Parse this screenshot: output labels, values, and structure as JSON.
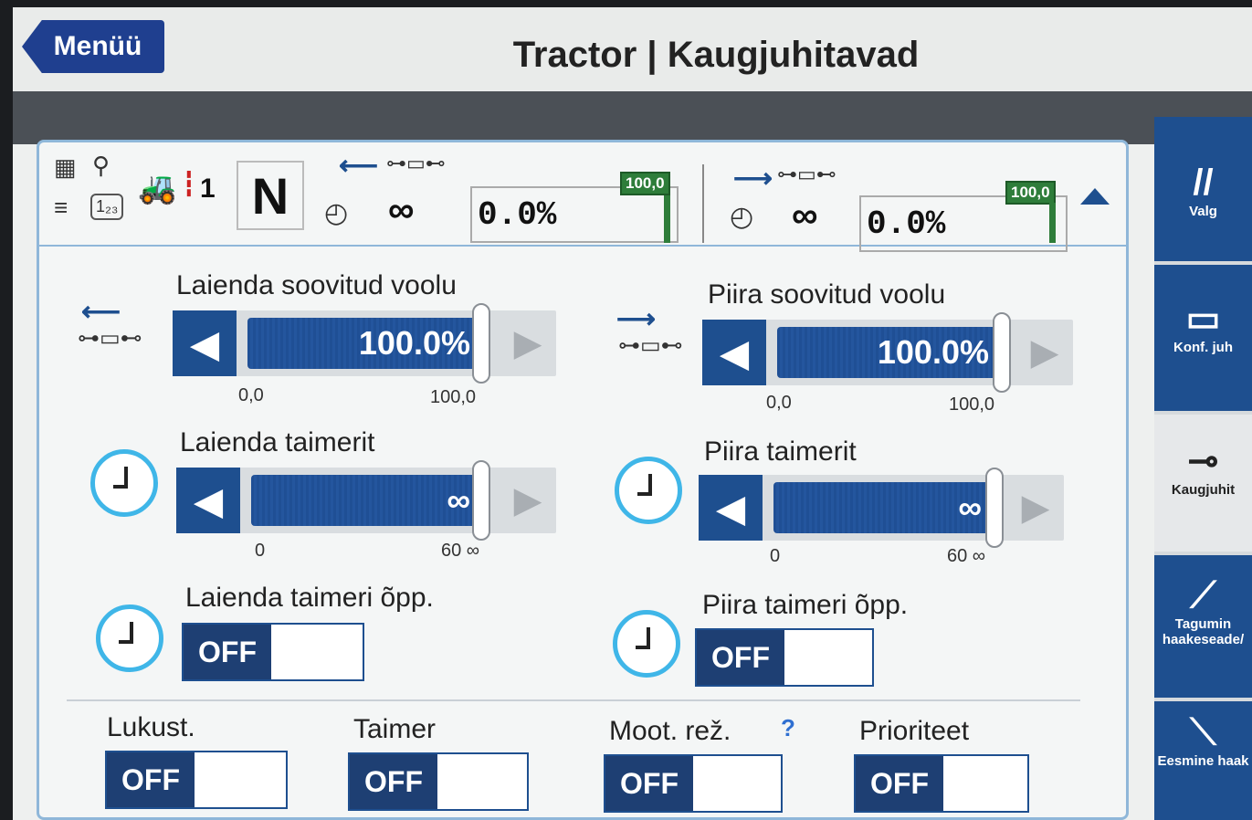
{
  "header": {
    "menu_label": "Menüü",
    "title": "Tractor | Kaugjuhitavad"
  },
  "status": {
    "gear": "N",
    "range_digit": "1",
    "left": {
      "timer": "∞",
      "percent": "0.0%",
      "flag": "100,0"
    },
    "right": {
      "timer": "∞",
      "percent": "0.0%",
      "flag": "100,0"
    }
  },
  "extend_flow": {
    "label": "Laienda soovitud voolu",
    "value": "100.0%",
    "min": "0,0",
    "max": "100,0"
  },
  "retract_flow": {
    "label": "Piira soovitud voolu",
    "value": "100.0%",
    "min": "0,0",
    "max": "100,0"
  },
  "extend_timer": {
    "label": "Laienda taimerit",
    "value": "∞",
    "min": "0",
    "max": "60 ∞"
  },
  "retract_timer": {
    "label": "Piira taimerit",
    "value": "∞",
    "min": "0",
    "max": "60 ∞"
  },
  "extend_learn": {
    "label": "Laienda taimeri õpp.",
    "value": "OFF"
  },
  "retract_learn": {
    "label": "Piira taimeri õpp.",
    "value": "OFF"
  },
  "bottom": {
    "lock": {
      "label": "Lukust.",
      "value": "OFF"
    },
    "timer": {
      "label": "Taimer",
      "value": "OFF"
    },
    "engine": {
      "label": "Moot. rež.",
      "value": "OFF",
      "help": "?"
    },
    "priority": {
      "label": "Prioriteet",
      "value": "OFF"
    }
  },
  "right_panel": {
    "item1": "Valg",
    "item2": "Konf. juh",
    "item3": "Kaugjuhit",
    "item4": "Tagumin haakeseade/",
    "item5": "Eesmine haak"
  },
  "colors": {
    "accent": "#1e4f8f",
    "flag": "#2e7d3a",
    "clock": "#3fb6e8"
  }
}
